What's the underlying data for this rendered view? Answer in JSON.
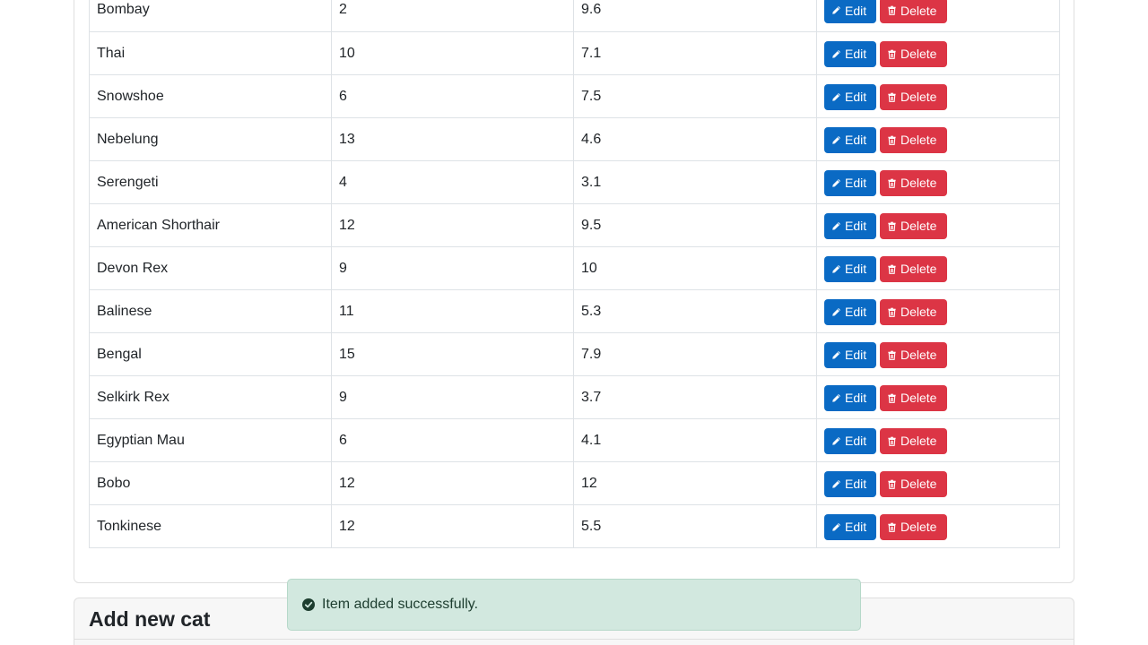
{
  "cats_table": {
    "rows": [
      {
        "breed": "Bombay",
        "col2": "2",
        "col3": "9.6"
      },
      {
        "breed": "Thai",
        "col2": "10",
        "col3": "7.1"
      },
      {
        "breed": "Snowshoe",
        "col2": "6",
        "col3": "7.5"
      },
      {
        "breed": "Nebelung",
        "col2": "13",
        "col3": "4.6"
      },
      {
        "breed": "Serengeti",
        "col2": "4",
        "col3": "3.1"
      },
      {
        "breed": "American Shorthair",
        "col2": "12",
        "col3": "9.5"
      },
      {
        "breed": "Devon Rex",
        "col2": "9",
        "col3": "10"
      },
      {
        "breed": "Balinese",
        "col2": "11",
        "col3": "5.3"
      },
      {
        "breed": "Bengal",
        "col2": "15",
        "col3": "7.9"
      },
      {
        "breed": "Selkirk Rex",
        "col2": "9",
        "col3": "3.7"
      },
      {
        "breed": "Egyptian Mau",
        "col2": "6",
        "col3": "4.1"
      },
      {
        "breed": "Bobo",
        "col2": "12",
        "col3": "12"
      },
      {
        "breed": "Tonkinese",
        "col2": "12",
        "col3": "5.5"
      }
    ],
    "edit_label": "Edit",
    "delete_label": "Delete"
  },
  "add_section": {
    "title": "Add new cat"
  },
  "toast": {
    "message": "Item added successfully."
  },
  "colors": {
    "edit": "#0a6ac4",
    "delete": "#dc3545",
    "toast_bg": "#d2e8df"
  },
  "icons": {
    "edit": "pencil-icon",
    "delete": "trash-icon",
    "toast": "check-circle-icon"
  }
}
